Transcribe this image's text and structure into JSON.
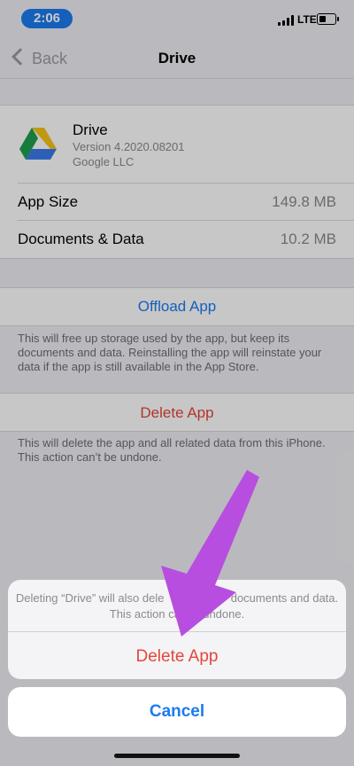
{
  "status_bar": {
    "time": "2:06",
    "network": "LTE"
  },
  "nav": {
    "back_label": "Back",
    "title": "Drive"
  },
  "app": {
    "name": "Drive",
    "version": "Version 4.2020.08201",
    "company": "Google LLC"
  },
  "rows": [
    {
      "label": "App Size",
      "value": "149.8 MB"
    },
    {
      "label": "Documents & Data",
      "value": "10.2 MB"
    }
  ],
  "offload": {
    "label": "Offload App",
    "footnote": "This will free up storage used by the app, but keep its documents and data. Reinstalling the app will reinstate your data if the app is still available in the App Store."
  },
  "delete": {
    "label": "Delete App",
    "footnote": "This will delete the app and all related data from this iPhone. This action can’t be undone."
  },
  "action_sheet": {
    "message_line1": "Deleting “Drive” will also dele",
    "message_line1_end": "documents and data.",
    "message_line2": "This action ca",
    "message_line2_end": "undone.",
    "delete_label": "Delete App",
    "cancel_label": "Cancel"
  },
  "colors": {
    "accent": "#1b7cf0",
    "destructive": "#e5453b",
    "arrow": "#b84ee0"
  }
}
